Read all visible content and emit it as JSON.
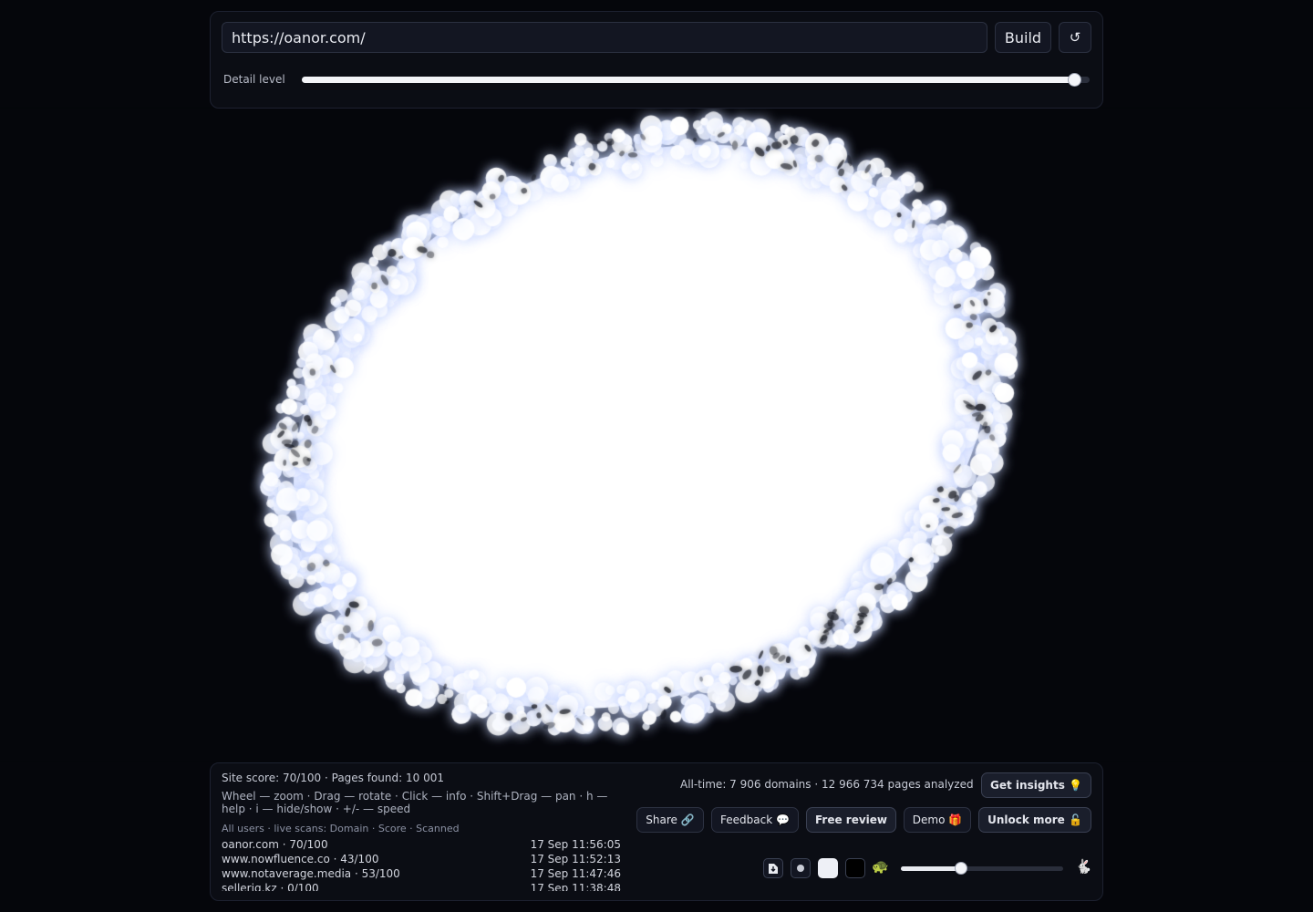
{
  "toolbar": {
    "url_value": "https://oanor.com/",
    "build_label": "Build",
    "refresh_icon": "↺",
    "detail_label": "Detail level",
    "detail_value": 0.98
  },
  "stats": {
    "site_score": "Site score: 70/100 · Pages found: 10 001",
    "help": "Wheel — zoom · Drag — rotate · Click — info · Shift+Drag — pan · h — help · i — hide/show · +/- — speed",
    "live_scans_header": "All users · live scans: Domain · Score · Scanned",
    "scans": [
      {
        "domain": "oanor.com · 70/100",
        "time": "17 Sep 11:56:05"
      },
      {
        "domain": "www.nowfluence.co · 43/100",
        "time": "17 Sep 11:52:13"
      },
      {
        "domain": "www.notaverage.media · 53/100",
        "time": "17 Sep 11:47:46"
      },
      {
        "domain": "sellerig.kz · 0/100",
        "time": "17 Sep 11:38:48"
      }
    ],
    "alltime": "All-time: 7 906 domains · 12 966 734 pages analyzed"
  },
  "actions": {
    "get_insights": "Get insights 💡",
    "share": "Share 🔗",
    "feedback": "Feedback 💬",
    "free_review": "Free review",
    "demo": "Demo 🎁",
    "unlock_more": "Unlock more 🔓"
  },
  "controls": {
    "icons": [
      "download-icon",
      "dot-icon",
      "light-swatch",
      "dark-swatch",
      "turtle-icon",
      "rabbit-icon"
    ],
    "turtle_glyph": "🐢",
    "rabbit_glyph": "🐇",
    "speed_value": 0.37
  },
  "colors": {
    "background": "#05060b",
    "panel": "#0b0d14",
    "cloud": "#ffffff"
  }
}
